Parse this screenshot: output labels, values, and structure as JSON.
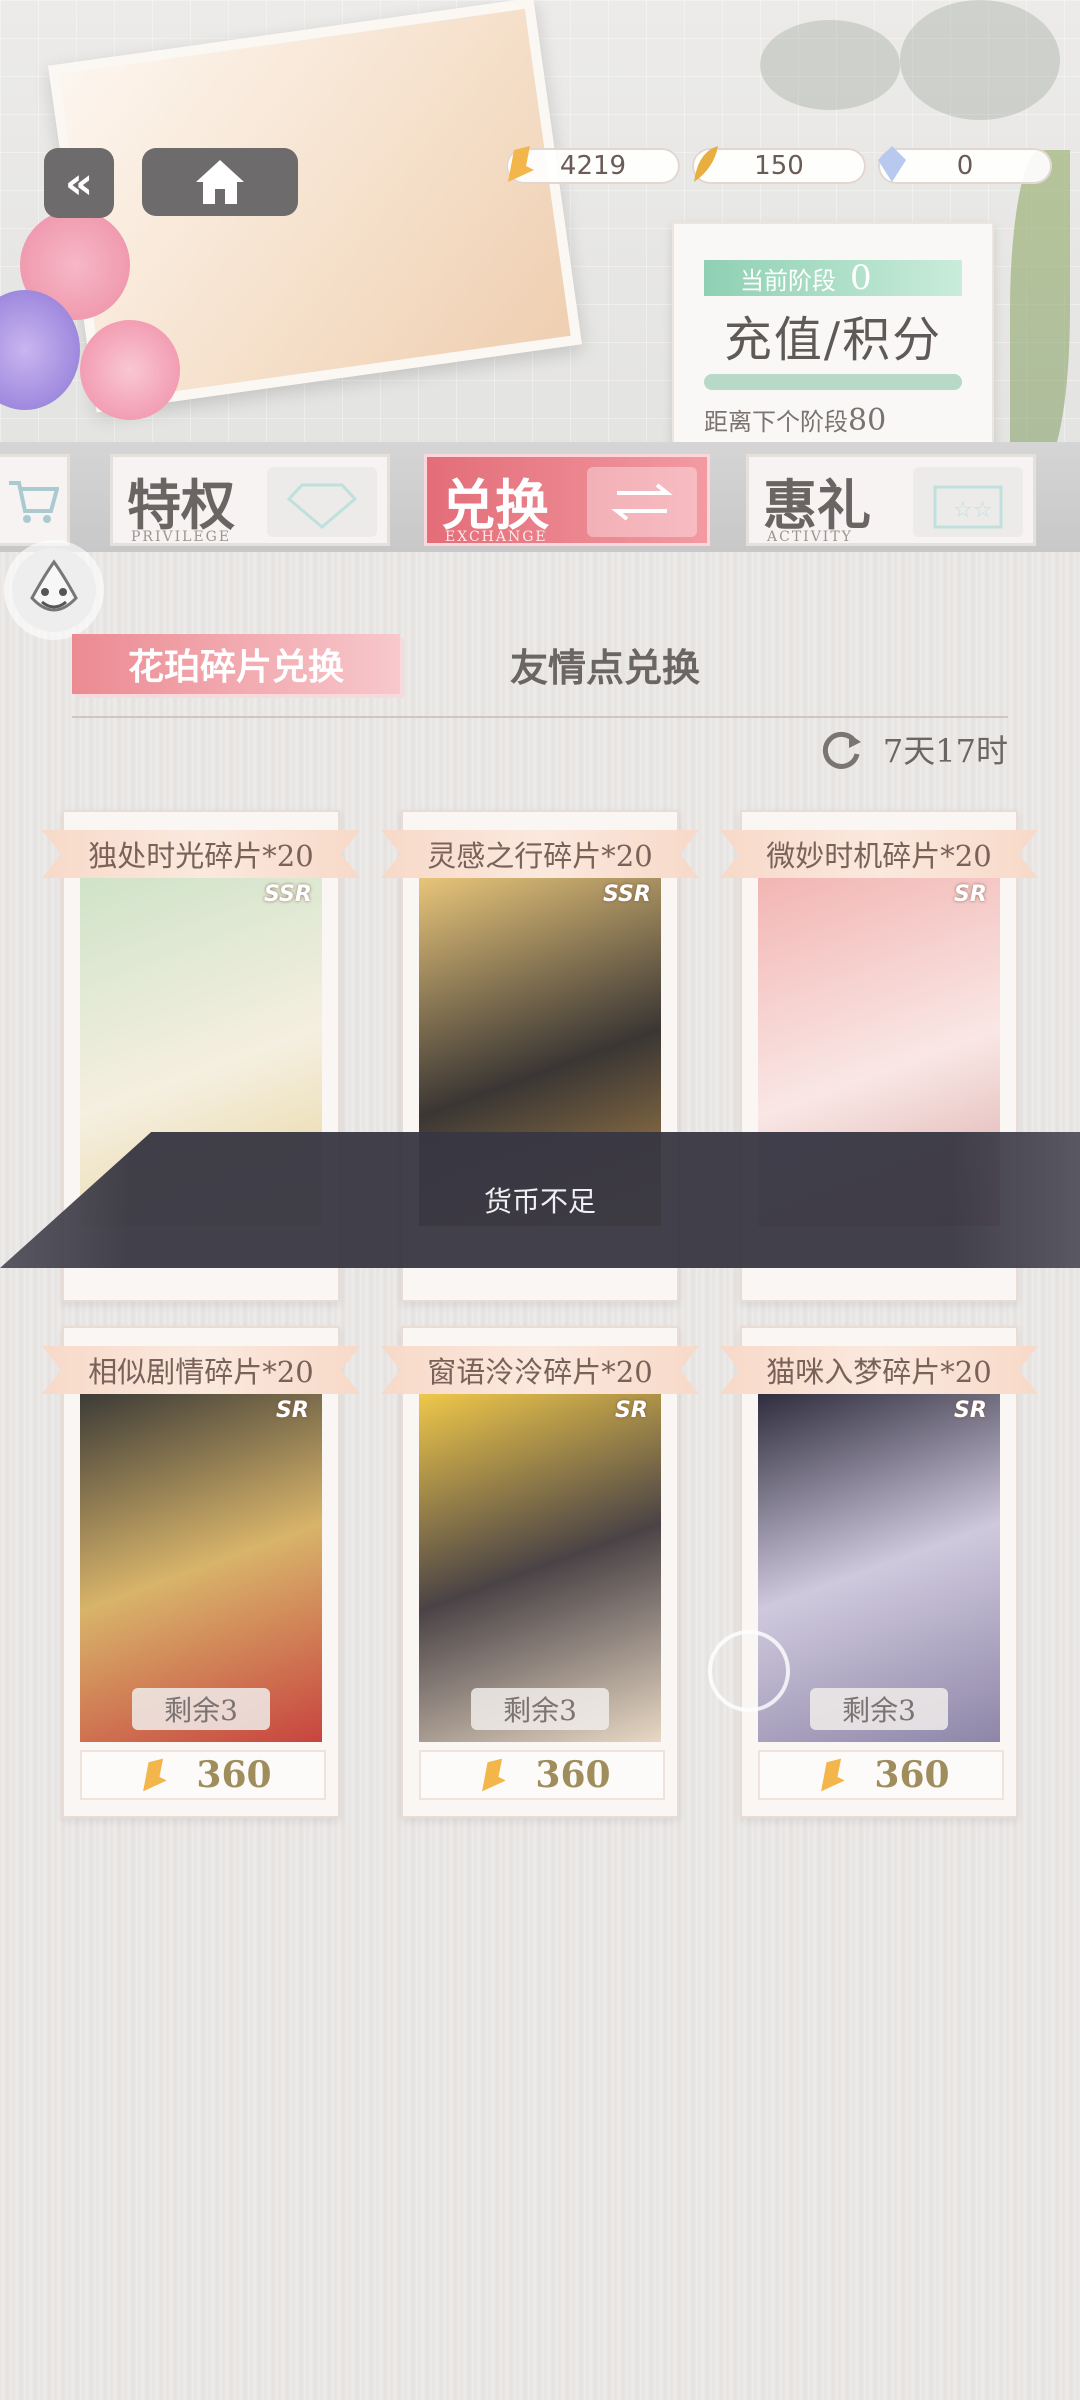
{
  "currencies": [
    {
      "icon": "amber-shard-icon",
      "value": "4219"
    },
    {
      "icon": "gold-feather-icon",
      "value": "150"
    },
    {
      "icon": "crystal-icon",
      "value": "0"
    }
  ],
  "stage": {
    "tag_label": "当前阶段",
    "stage_number": "0",
    "title": "充值/积分",
    "next_label": "距离下个阶段",
    "next_value": "80"
  },
  "tabs": [
    {
      "cn": "特权",
      "en": "PRIVILEGE"
    },
    {
      "cn": "兑换",
      "en": "EXCHANGE",
      "active": true
    },
    {
      "cn": "惠礼",
      "en": "ACTIVITY"
    }
  ],
  "subtabs": {
    "active": "花珀碎片兑换",
    "other": "友情点兑换"
  },
  "refresh_time": "7天17时",
  "cards": [
    {
      "title": "独处时光碎片*20",
      "rank": "SSR",
      "remaining": "",
      "price": "",
      "palette": [
        "#cfe3c9",
        "#f5efe0",
        "#e6d39a"
      ]
    },
    {
      "title": "灵感之行碎片*20",
      "rank": "SSR",
      "remaining": "",
      "price": "",
      "palette": [
        "#e9c67a",
        "#3a3634",
        "#b58b4b"
      ]
    },
    {
      "title": "微妙时机碎片*20",
      "rank": "SR",
      "remaining": "",
      "price": "",
      "palette": [
        "#f2b5b3",
        "#f9e7e5",
        "#d8a8a6"
      ]
    },
    {
      "title": "相似剧情碎片*20",
      "rank": "SR",
      "remaining": "剩余3",
      "price": "360",
      "palette": [
        "#3b3a36",
        "#d8b46a",
        "#c8443f"
      ]
    },
    {
      "title": "窗语泠泠碎片*20",
      "rank": "SR",
      "remaining": "剩余3",
      "price": "360",
      "palette": [
        "#f1c94a",
        "#4a4346",
        "#e8d8c4"
      ]
    },
    {
      "title": "猫咪入梦碎片*20",
      "rank": "SR",
      "remaining": "剩余3",
      "price": "360",
      "palette": [
        "#2d2b3c",
        "#cfc9dd",
        "#8e86a8"
      ]
    }
  ],
  "toast": "货币不足",
  "colors": {
    "accent": "#e36d78",
    "mint": "#8fd0b3",
    "price": "#a08d5c"
  }
}
